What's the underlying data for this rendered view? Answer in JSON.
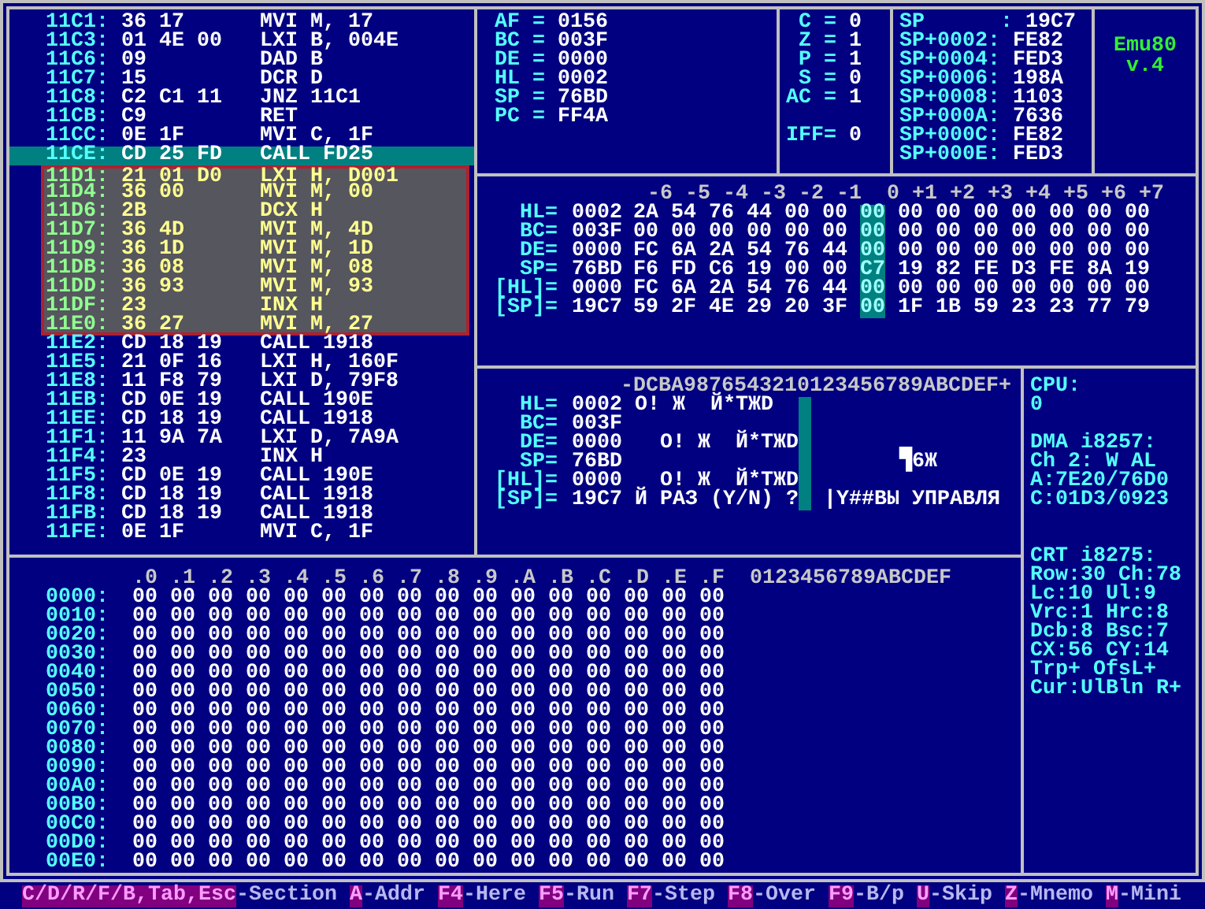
{
  "disassembly": [
    {
      "address": "11C1:",
      "bytes": "36 17",
      "mnemonic": "MVI M, 17",
      "current": false,
      "marked": false
    },
    {
      "address": "11C3:",
      "bytes": "01 4E 00",
      "mnemonic": "LXI B, 004E",
      "current": false,
      "marked": false
    },
    {
      "address": "11C6:",
      "bytes": "09",
      "mnemonic": "DAD B",
      "current": false,
      "marked": false
    },
    {
      "address": "11C7:",
      "bytes": "15",
      "mnemonic": "DCR D",
      "current": false,
      "marked": false
    },
    {
      "address": "11C8:",
      "bytes": "C2 C1 11",
      "mnemonic": "JNZ 11C1",
      "current": false,
      "marked": false
    },
    {
      "address": "11CB:",
      "bytes": "C9",
      "mnemonic": "RET",
      "current": false,
      "marked": false
    },
    {
      "address": "11CC:",
      "bytes": "0E 1F",
      "mnemonic": "MVI C, 1F",
      "current": false,
      "marked": false
    },
    {
      "address": "11CE:",
      "bytes": "CD 25 FD",
      "mnemonic": "CALL FD25",
      "current": true,
      "marked": false
    },
    {
      "address": "11D1:",
      "bytes": "21 01 D0",
      "mnemonic": "LXI H, D001",
      "current": false,
      "marked": true
    },
    {
      "address": "11D4:",
      "bytes": "36 00",
      "mnemonic": "MVI M, 00",
      "current": false,
      "marked": true
    },
    {
      "address": "11D6:",
      "bytes": "2B",
      "mnemonic": "DCX H",
      "current": false,
      "marked": true
    },
    {
      "address": "11D7:",
      "bytes": "36 4D",
      "mnemonic": "MVI M, 4D",
      "current": false,
      "marked": true
    },
    {
      "address": "11D9:",
      "bytes": "36 1D",
      "mnemonic": "MVI M, 1D",
      "current": false,
      "marked": true
    },
    {
      "address": "11DB:",
      "bytes": "36 08",
      "mnemonic": "MVI M, 08",
      "current": false,
      "marked": true
    },
    {
      "address": "11DD:",
      "bytes": "36 93",
      "mnemonic": "MVI M, 93",
      "current": false,
      "marked": true
    },
    {
      "address": "11DF:",
      "bytes": "23",
      "mnemonic": "INX H",
      "current": false,
      "marked": true
    },
    {
      "address": "11E0:",
      "bytes": "36 27",
      "mnemonic": "MVI M, 27",
      "current": false,
      "marked": true
    },
    {
      "address": "11E2:",
      "bytes": "CD 18 19",
      "mnemonic": "CALL 1918",
      "current": false,
      "marked": false
    },
    {
      "address": "11E5:",
      "bytes": "21 0F 16",
      "mnemonic": "LXI H, 160F",
      "current": false,
      "marked": false
    },
    {
      "address": "11E8:",
      "bytes": "11 F8 79",
      "mnemonic": "LXI D, 79F8",
      "current": false,
      "marked": false
    },
    {
      "address": "11EB:",
      "bytes": "CD 0E 19",
      "mnemonic": "CALL 190E",
      "current": false,
      "marked": false
    },
    {
      "address": "11EE:",
      "bytes": "CD 18 19",
      "mnemonic": "CALL 1918",
      "current": false,
      "marked": false
    },
    {
      "address": "11F1:",
      "bytes": "11 9A 7A",
      "mnemonic": "LXI D, 7A9A",
      "current": false,
      "marked": false
    },
    {
      "address": "11F4:",
      "bytes": "23",
      "mnemonic": "INX H",
      "current": false,
      "marked": false
    },
    {
      "address": "11F5:",
      "bytes": "CD 0E 19",
      "mnemonic": "CALL 190E",
      "current": false,
      "marked": false
    },
    {
      "address": "11F8:",
      "bytes": "CD 18 19",
      "mnemonic": "CALL 1918",
      "current": false,
      "marked": false
    },
    {
      "address": "11FB:",
      "bytes": "CD 18 19",
      "mnemonic": "CALL 1918",
      "current": false,
      "marked": false
    },
    {
      "address": "11FE:",
      "bytes": "0E 1F",
      "mnemonic": "MVI C, 1F",
      "current": false,
      "marked": false
    }
  ],
  "registers": [
    {
      "label": "AF =",
      "value": "0156"
    },
    {
      "label": "BC =",
      "value": "003F"
    },
    {
      "label": "DE =",
      "value": "0000"
    },
    {
      "label": "HL =",
      "value": "0002"
    },
    {
      "label": "SP =",
      "value": "76BD"
    },
    {
      "label": "PC =",
      "value": "FF4A"
    }
  ],
  "flags": [
    {
      "label": "C =",
      "value": "0"
    },
    {
      "label": "Z =",
      "value": "1"
    },
    {
      "label": "P =",
      "value": "1"
    },
    {
      "label": "S =",
      "value": "0"
    },
    {
      "label": "AC =",
      "value": "1"
    }
  ],
  "interrupt_flag": {
    "label": "IFF=",
    "value": "0"
  },
  "stack": [
    {
      "label": "SP      :",
      "value": "19C7"
    },
    {
      "label": "SP+0002:",
      "value": "FE82"
    },
    {
      "label": "SP+0004:",
      "value": "FED3"
    },
    {
      "label": "SP+0006:",
      "value": "198A"
    },
    {
      "label": "SP+0008:",
      "value": "1103"
    },
    {
      "label": "SP+000A:",
      "value": "7636"
    },
    {
      "label": "SP+000C:",
      "value": "FE82"
    },
    {
      "label": "SP+000E:",
      "value": "FED3"
    }
  ],
  "logo": {
    "name": "Emu80",
    "version": "v.4"
  },
  "reg_memory": {
    "columns": [
      {
        "label": "-6",
        "selected": false
      },
      {
        "label": "-5",
        "selected": false
      },
      {
        "label": "-4",
        "selected": false
      },
      {
        "label": "-3",
        "selected": false
      },
      {
        "label": "-2",
        "selected": false
      },
      {
        "label": "-1",
        "selected": false
      },
      {
        "label": "0",
        "selected": true
      },
      {
        "label": "+1",
        "selected": false
      },
      {
        "label": "+2",
        "selected": false
      },
      {
        "label": "+3",
        "selected": false
      },
      {
        "label": "+4",
        "selected": false
      },
      {
        "label": "+5",
        "selected": false
      },
      {
        "label": "+6",
        "selected": false
      },
      {
        "label": "+7",
        "selected": false
      }
    ],
    "rows": [
      {
        "label": "HL=",
        "base": "0002",
        "bytes": [
          "2A",
          "54",
          "76",
          "44",
          "00",
          "00",
          "00",
          "00",
          "00",
          "00",
          "00",
          "00",
          "00",
          "00"
        ]
      },
      {
        "label": "BC=",
        "base": "003F",
        "bytes": [
          "00",
          "00",
          "00",
          "00",
          "00",
          "00",
          "00",
          "00",
          "00",
          "00",
          "00",
          "00",
          "00",
          "00"
        ]
      },
      {
        "label": "DE=",
        "base": "0000",
        "bytes": [
          "FC",
          "6A",
          "2A",
          "54",
          "76",
          "44",
          "00",
          "00",
          "00",
          "00",
          "00",
          "00",
          "00",
          "00"
        ]
      },
      {
        "label": "SP=",
        "base": "76BD",
        "bytes": [
          "F6",
          "FD",
          "C6",
          "19",
          "00",
          "00",
          "C7",
          "19",
          "82",
          "FE",
          "D3",
          "FE",
          "8A",
          "19"
        ]
      },
      {
        "label": "[HL]=",
        "base": "0000",
        "bytes": [
          "FC",
          "6A",
          "2A",
          "54",
          "76",
          "44",
          "00",
          "00",
          "00",
          "00",
          "00",
          "00",
          "00",
          "00"
        ]
      },
      {
        "label": "[SP]=",
        "base": "19C7",
        "bytes": [
          "59",
          "2F",
          "4E",
          "29",
          "20",
          "3F",
          "00",
          "1F",
          "1B",
          "59",
          "23",
          "23",
          "77",
          "79"
        ]
      }
    ]
  },
  "char_dump": {
    "header": "-DCBA9876543210123456789ABCDEF+",
    "rows": [
      {
        "label": "HL=",
        "base": "0002",
        "left": " O! Ж  Й*ТЖD",
        "cursor": true
      },
      {
        "label": "BC=",
        "base": "003F",
        "cursor": true
      },
      {
        "label": "DE=",
        "base": "0000",
        "left": "   O! Ж  Й*ТЖD",
        "cursor": true
      },
      {
        "label": "SP=",
        "base": "76BD",
        "right": "       ▜6Ж",
        "cursor": true
      },
      {
        "label": "[HL]=",
        "base": "0000",
        "left": "   O! Ж  Й*ТЖD",
        "cursor": true
      },
      {
        "label": "[SP]=",
        "base": "19C7",
        "left": " Й РАЗ (Y/N) ?",
        "right": " |Y##ВЫ УПРАВЛЯ",
        "cursor": true
      }
    ]
  },
  "hex_dump": {
    "columns": [
      ".0",
      ".1",
      ".2",
      ".3",
      ".4",
      ".5",
      ".6",
      ".7",
      ".8",
      ".9",
      ".A",
      ".B",
      ".C",
      ".D",
      ".E",
      ".F"
    ],
    "ascii_header": "0123456789ABCDEF",
    "rows": [
      {
        "address": "0000:",
        "bytes": [
          "00",
          "00",
          "00",
          "00",
          "00",
          "00",
          "00",
          "00",
          "00",
          "00",
          "00",
          "00",
          "00",
          "00",
          "00",
          "00"
        ]
      },
      {
        "address": "0010:",
        "bytes": [
          "00",
          "00",
          "00",
          "00",
          "00",
          "00",
          "00",
          "00",
          "00",
          "00",
          "00",
          "00",
          "00",
          "00",
          "00",
          "00"
        ]
      },
      {
        "address": "0020:",
        "bytes": [
          "00",
          "00",
          "00",
          "00",
          "00",
          "00",
          "00",
          "00",
          "00",
          "00",
          "00",
          "00",
          "00",
          "00",
          "00",
          "00"
        ]
      },
      {
        "address": "0030:",
        "bytes": [
          "00",
          "00",
          "00",
          "00",
          "00",
          "00",
          "00",
          "00",
          "00",
          "00",
          "00",
          "00",
          "00",
          "00",
          "00",
          "00"
        ]
      },
      {
        "address": "0040:",
        "bytes": [
          "00",
          "00",
          "00",
          "00",
          "00",
          "00",
          "00",
          "00",
          "00",
          "00",
          "00",
          "00",
          "00",
          "00",
          "00",
          "00"
        ]
      },
      {
        "address": "0050:",
        "bytes": [
          "00",
          "00",
          "00",
          "00",
          "00",
          "00",
          "00",
          "00",
          "00",
          "00",
          "00",
          "00",
          "00",
          "00",
          "00",
          "00"
        ]
      },
      {
        "address": "0060:",
        "bytes": [
          "00",
          "00",
          "00",
          "00",
          "00",
          "00",
          "00",
          "00",
          "00",
          "00",
          "00",
          "00",
          "00",
          "00",
          "00",
          "00"
        ]
      },
      {
        "address": "0070:",
        "bytes": [
          "00",
          "00",
          "00",
          "00",
          "00",
          "00",
          "00",
          "00",
          "00",
          "00",
          "00",
          "00",
          "00",
          "00",
          "00",
          "00"
        ]
      },
      {
        "address": "0080:",
        "bytes": [
          "00",
          "00",
          "00",
          "00",
          "00",
          "00",
          "00",
          "00",
          "00",
          "00",
          "00",
          "00",
          "00",
          "00",
          "00",
          "00"
        ]
      },
      {
        "address": "0090:",
        "bytes": [
          "00",
          "00",
          "00",
          "00",
          "00",
          "00",
          "00",
          "00",
          "00",
          "00",
          "00",
          "00",
          "00",
          "00",
          "00",
          "00"
        ]
      },
      {
        "address": "00A0:",
        "bytes": [
          "00",
          "00",
          "00",
          "00",
          "00",
          "00",
          "00",
          "00",
          "00",
          "00",
          "00",
          "00",
          "00",
          "00",
          "00",
          "00"
        ]
      },
      {
        "address": "00B0:",
        "bytes": [
          "00",
          "00",
          "00",
          "00",
          "00",
          "00",
          "00",
          "00",
          "00",
          "00",
          "00",
          "00",
          "00",
          "00",
          "00",
          "00"
        ]
      },
      {
        "address": "00C0:",
        "bytes": [
          "00",
          "00",
          "00",
          "00",
          "00",
          "00",
          "00",
          "00",
          "00",
          "00",
          "00",
          "00",
          "00",
          "00",
          "00",
          "00"
        ]
      },
      {
        "address": "00D0:",
        "bytes": [
          "00",
          "00",
          "00",
          "00",
          "00",
          "00",
          "00",
          "00",
          "00",
          "00",
          "00",
          "00",
          "00",
          "00",
          "00",
          "00"
        ]
      },
      {
        "address": "00E0:",
        "bytes": [
          "00",
          "00",
          "00",
          "00",
          "00",
          "00",
          "00",
          "00",
          "00",
          "00",
          "00",
          "00",
          "00",
          "00",
          "00",
          "00"
        ]
      }
    ]
  },
  "cpu_info": [
    {
      "lines": [
        "CPU:",
        "0"
      ]
    },
    {
      "lines": [
        "DMA i8257:",
        "Ch 2: W AL",
        "A:7E20/76D0",
        "C:01D3/0923"
      ]
    },
    {
      "lines": [
        "CRT i8275:",
        "Row:30 Ch:78",
        "Lc:10 Ul:9",
        "Vrc:1 Hrc:8",
        "Dcb:8 Bsc:7",
        "CX:56 CY:14",
        "Trp+ OfsL+",
        "Cur:UlBln R+"
      ]
    }
  ],
  "status_bar": [
    {
      "key": "C/D/R/F/B,Tab,Esc",
      "label": "-Section"
    },
    {
      "key": "A",
      "label": "-Addr"
    },
    {
      "key": "F4",
      "label": "-Here"
    },
    {
      "key": "F5",
      "label": "-Run"
    },
    {
      "key": "F7",
      "label": "-Step"
    },
    {
      "key": "F8",
      "label": "-Over"
    },
    {
      "key": "F9",
      "label": "-B/p"
    },
    {
      "key": "U",
      "label": "-Skip"
    },
    {
      "key": "Z",
      "label": "-Mnemo"
    },
    {
      "key": "M",
      "label": "-Mini"
    }
  ]
}
